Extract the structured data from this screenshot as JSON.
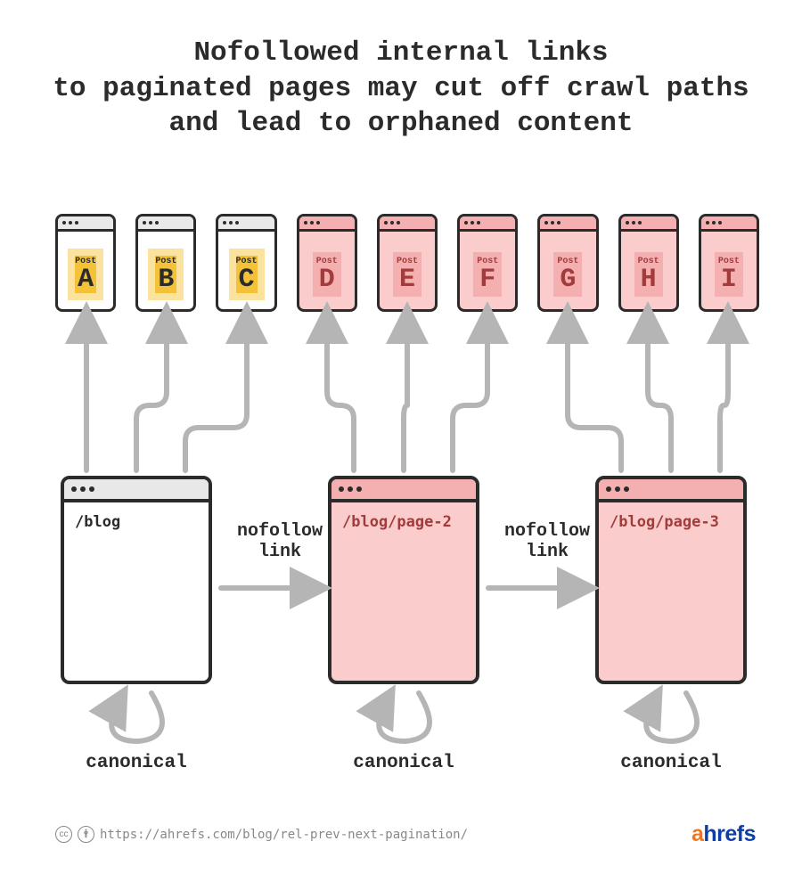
{
  "title_lines": [
    "Nofollowed internal links",
    "to paginated pages may cut off crawl paths",
    "and lead to orphaned content"
  ],
  "post_label": "Post",
  "posts": [
    {
      "letter": "A",
      "state": "ok"
    },
    {
      "letter": "B",
      "state": "ok"
    },
    {
      "letter": "C",
      "state": "ok"
    },
    {
      "letter": "D",
      "state": "bad"
    },
    {
      "letter": "E",
      "state": "bad"
    },
    {
      "letter": "F",
      "state": "bad"
    },
    {
      "letter": "G",
      "state": "bad"
    },
    {
      "letter": "H",
      "state": "bad"
    },
    {
      "letter": "I",
      "state": "bad"
    }
  ],
  "pages": [
    {
      "path": "/blog",
      "state": "ok"
    },
    {
      "path": "/blog/page-2",
      "state": "bad"
    },
    {
      "path": "/blog/page-3",
      "state": "bad"
    }
  ],
  "nofollow_label": "nofollow link",
  "canonical_label": "canonical",
  "footer": {
    "cc_icons": [
      "cc",
      "by"
    ],
    "url": "https://ahrefs.com/blog/rel-prev-next-pagination/",
    "brand": "ahrefs"
  }
}
